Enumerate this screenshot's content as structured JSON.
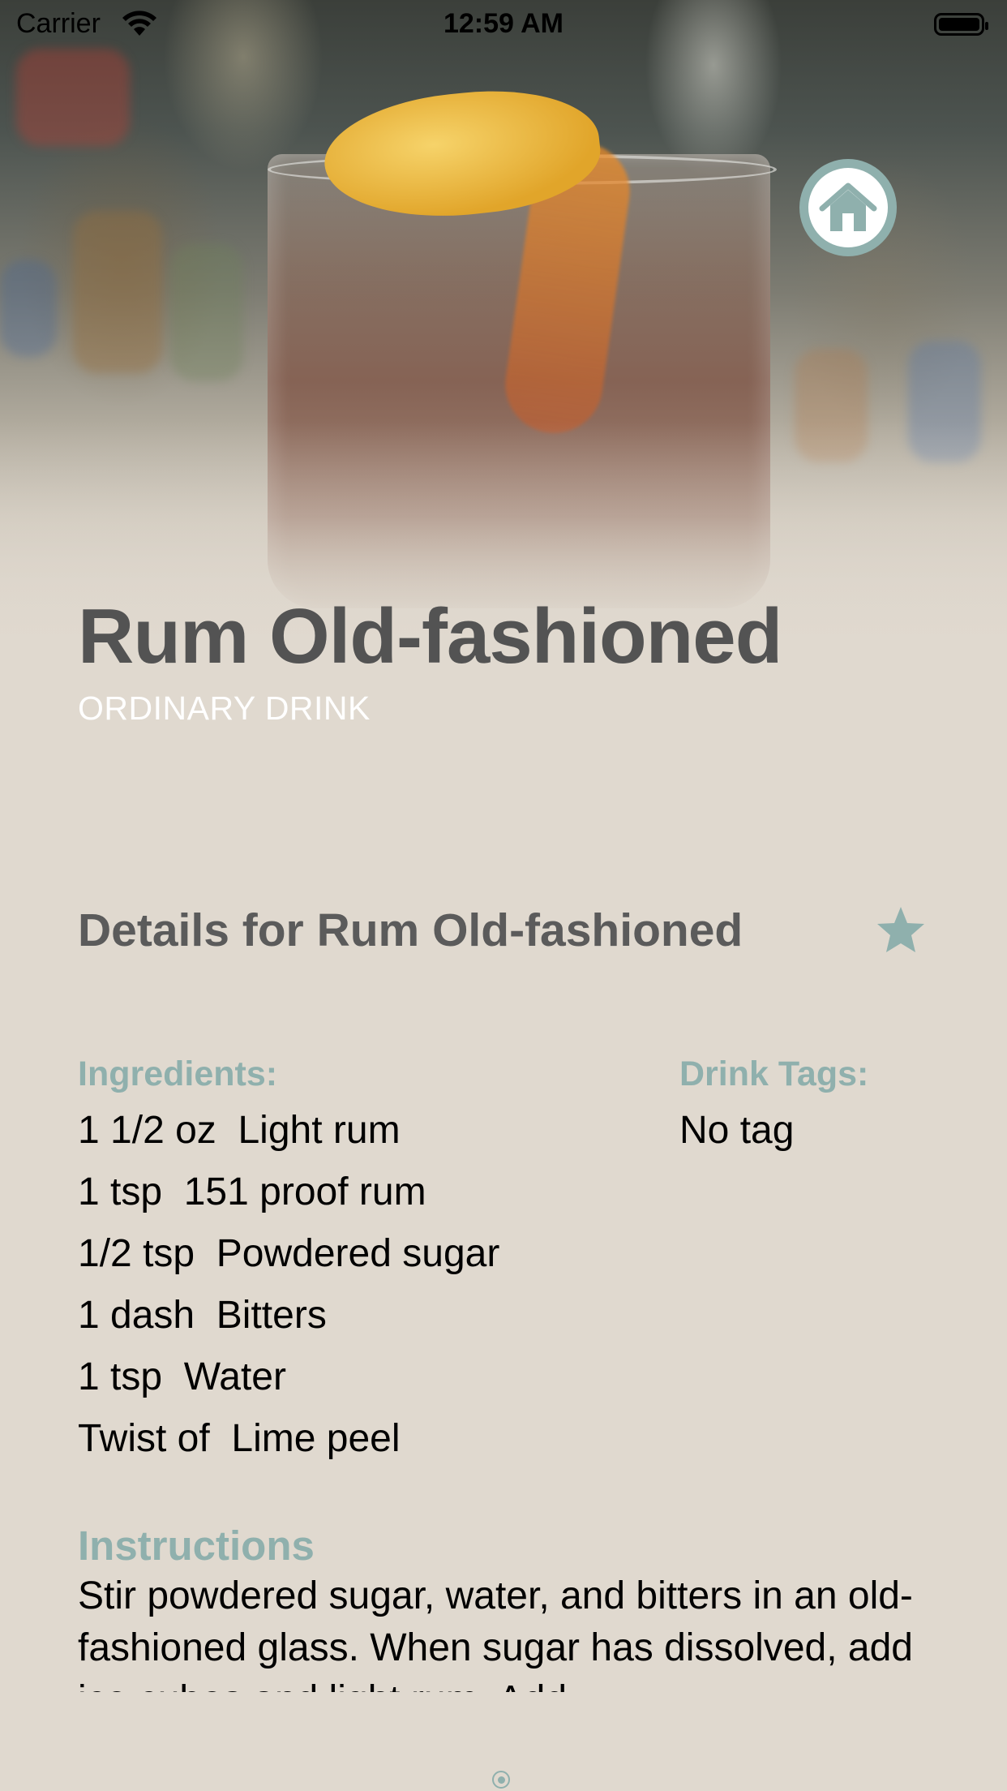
{
  "status_bar": {
    "carrier": "Carrier",
    "time": "12:59 AM"
  },
  "hero": {
    "image": "cocktail-photo",
    "title": "Rum Old-fashioned",
    "category": "ORDINARY DRINK"
  },
  "home_button": {
    "icon": "house-icon"
  },
  "details": {
    "title": "Details for Rum Old-fashioned",
    "favorite_icon": "star-icon"
  },
  "ingredients": {
    "label": "Ingredients:",
    "items": [
      "1 1/2 oz  Light rum",
      "1 tsp  151 proof rum",
      "1/2 tsp  Powdered sugar",
      "1 dash  Bitters",
      "1 tsp  Water",
      "Twist of  Lime peel"
    ]
  },
  "tags": {
    "label": "Drink Tags:",
    "value": "No tag"
  },
  "instructions": {
    "label": "Instructions",
    "text": "Stir powdered sugar, water, and bitters in an old-fashioned glass. When sugar has dissolved, add ice cubes and light rum. Add"
  },
  "colors": {
    "background": "#e0d9cf",
    "accent": "#8fb0ad",
    "title": "#535353"
  }
}
